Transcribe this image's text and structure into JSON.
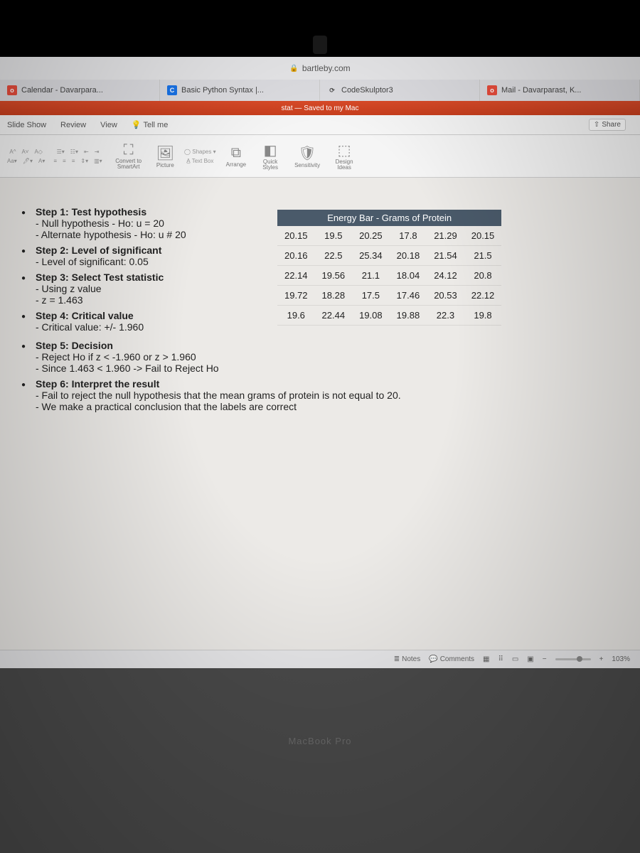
{
  "browser": {
    "url_host": "bartleby.com",
    "tabs": [
      {
        "label": "Calendar - Davarpara..."
      },
      {
        "label": "Basic Python Syntax |..."
      },
      {
        "label": "CodeSkulptor3"
      },
      {
        "label": "Mail - Davarparast, K..."
      }
    ]
  },
  "pp": {
    "title": "stat — Saved to my Mac",
    "ribbon_tabs": [
      "Slide Show",
      "Review",
      "View",
      "Tell me"
    ],
    "share": "Share",
    "buttons": {
      "convert": "Convert to SmartArt",
      "picture": "Picture",
      "shapes": "Shapes",
      "textbox": "Text Box",
      "arrange": "Arrange",
      "quickstyles": "Quick Styles",
      "sensitivity": "Sensitivity",
      "designideas": "Design Ideas"
    }
  },
  "slide": {
    "step1_title": "Step 1: Test hypothesis",
    "step1_a": "- Null hypothesis - Ho: u = 20",
    "step1_b": "- Alternate hypothesis - Ho: u # 20",
    "step2_title": "Step 2: Level of significant",
    "step2_a": "- Level of significant: 0.05",
    "step3_title": "Step 3: Select Test statistic",
    "step3_a": "- Using z value",
    "step3_b": "- z = 1.463",
    "step4_title": "Step 4: Critical value",
    "step4_a": "- Critical value: +/- 1.960",
    "step5_title": "Step 5: Decision",
    "step5_a": "- Reject Ho if z < -1.960 or z > 1.960",
    "step5_b": "- Since 1.463 < 1.960 -> Fail to Reject Ho",
    "step6_title": "Step 6: Interpret the result",
    "step6_a": "- Fail to reject the null hypothesis that the mean grams of protein is not equal to 20.",
    "step6_b": "- We make a practical conclusion that the labels are correct",
    "table_title": "Energy Bar - Grams of Protein"
  },
  "chart_data": {
    "type": "table",
    "title": "Energy Bar - Grams of Protein",
    "rows": [
      [
        20.15,
        19.5,
        20.25,
        17.8,
        21.29,
        20.15
      ],
      [
        20.16,
        22.5,
        25.34,
        20.18,
        21.54,
        21.5
      ],
      [
        22.14,
        19.56,
        21.1,
        18.04,
        24.12,
        20.8
      ],
      [
        19.72,
        18.28,
        17.5,
        17.46,
        20.53,
        22.12
      ],
      [
        19.6,
        22.44,
        19.08,
        19.88,
        22.3,
        19.8
      ]
    ]
  },
  "statusbar": {
    "notes": "Notes",
    "comments": "Comments",
    "zoom": "103%"
  },
  "mac": "MacBook Pro"
}
